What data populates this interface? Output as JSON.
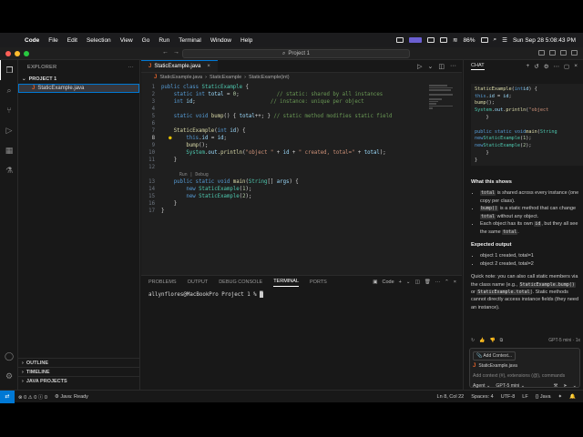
{
  "menubar": {
    "app": "Code",
    "items": [
      "File",
      "Edit",
      "Selection",
      "View",
      "Go",
      "Run",
      "Terminal",
      "Window",
      "Help"
    ],
    "battery": "86%",
    "clock": "Sun Sep 28  5:08:43 PM"
  },
  "titlebar": {
    "search": "Project 1"
  },
  "sidebar": {
    "title": "EXPLORER",
    "project": "PROJECT 1",
    "file": "StaticExample.java",
    "sections": [
      "OUTLINE",
      "TIMELINE",
      "JAVA PROJECTS"
    ]
  },
  "editor": {
    "tab": "StaticExample.java",
    "breadcrumb": [
      "StaticExample.java",
      "StaticExample",
      "StaticExample(int)"
    ],
    "codelens": "Run | Debug",
    "lines": [
      "1",
      "2",
      "3",
      "4",
      "5",
      "6",
      "7",
      "8",
      "9",
      "10",
      "11",
      "12",
      "13",
      "14",
      "15",
      "16",
      "17"
    ]
  },
  "panel": {
    "tabs": [
      "PROBLEMS",
      "OUTPUT",
      "DEBUG CONSOLE",
      "TERMINAL",
      "PORTS"
    ],
    "active": "TERMINAL",
    "shell_label": "Code",
    "prompt": "allynflores@MacBookPro Project 1 % "
  },
  "chat": {
    "title": "CHAT",
    "h1": "What this shows",
    "h2": "Expected output",
    "out1": "object 1 created, total=1",
    "out2": "object 2 created, total=2",
    "model_note": "GPT-5 mini · 1x",
    "add_context": "Add Context...",
    "ctx_file": "StaticExample.java",
    "placeholder": "Add context (#), extensions (@), commands",
    "mode": "Agent",
    "model": "GPT-5 mini"
  },
  "statusbar": {
    "errors": "0",
    "warnings": "0",
    "info": "0",
    "java": "Java: Ready",
    "position": "Ln 8, Col 22",
    "spaces": "Spaces: 4",
    "encoding": "UTF-8",
    "eol": "LF",
    "lang": "{} Java"
  },
  "colors": {
    "accent": "#0078d4",
    "keyword": "#569cd6",
    "type": "#4ec9b0",
    "comment": "#6a9955",
    "string": "#ce9178"
  }
}
